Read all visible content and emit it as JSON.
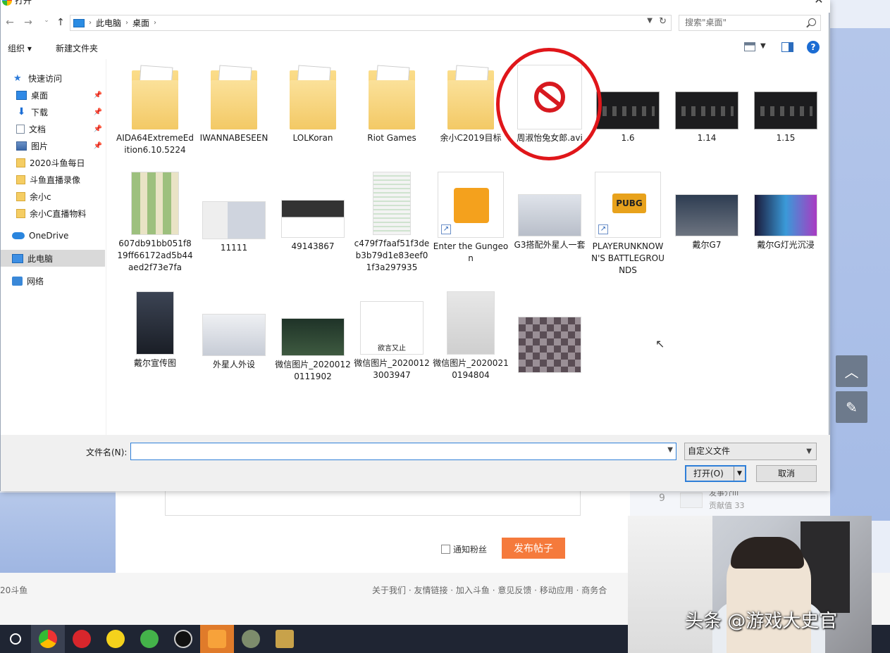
{
  "dialog": {
    "title": "打开",
    "breadcrumb": [
      "此电脑",
      "桌面"
    ],
    "search_placeholder": "搜索\"桌面\"",
    "toolbar": {
      "organize": "组织 ▾",
      "new_folder": "新建文件夹"
    },
    "nav": [
      {
        "label": "快速访问",
        "icon": "star-icon"
      },
      {
        "label": "桌面",
        "icon": "desktop-icon",
        "pinned": true
      },
      {
        "label": "下载",
        "icon": "download-icon",
        "pinned": true
      },
      {
        "label": "文档",
        "icon": "document-icon",
        "pinned": true
      },
      {
        "label": "图片",
        "icon": "pictures-icon",
        "pinned": true
      },
      {
        "label": "2020斗鱼每日",
        "icon": "folder-icon"
      },
      {
        "label": "斗鱼直播录像",
        "icon": "folder-icon"
      },
      {
        "label": "余小c",
        "icon": "folder-icon"
      },
      {
        "label": "余小C直播物料",
        "icon": "folder-icon"
      },
      {
        "label": "OneDrive",
        "icon": "cloud-icon"
      },
      {
        "label": "此电脑",
        "icon": "pc-icon"
      },
      {
        "label": "网络",
        "icon": "network-icon"
      }
    ],
    "files_row1": [
      {
        "name": "AIDA64ExtremeEdition6.10.5224",
        "kind": "folder"
      },
      {
        "name": "IWANNABESEEN",
        "kind": "folder"
      },
      {
        "name": "LOLKoran",
        "kind": "folder"
      },
      {
        "name": "Riot Games",
        "kind": "folder"
      },
      {
        "name": "余小C2019目标",
        "kind": "folder"
      },
      {
        "name": "周淑怡兔女郎.avi",
        "kind": "blocked"
      },
      {
        "name": "1.6",
        "kind": "dark"
      },
      {
        "name": "1.14",
        "kind": "dark"
      },
      {
        "name": "1.15",
        "kind": "dark"
      }
    ],
    "files_row2": [
      {
        "name": "607db91bb051f819ff66172ad5b44aed2f73e7fa"
      },
      {
        "name": "11111"
      },
      {
        "name": "49143867"
      },
      {
        "name": "c479f7faaf51f3deb3b79d1e83eef01f3a297935"
      },
      {
        "name": "Enter the Gungeon"
      },
      {
        "name": "G3搭配外星人一套"
      },
      {
        "name": "PLAYERUNKNOWN'S BATTLEGROUNDS"
      },
      {
        "name": "戴尔G7"
      },
      {
        "name": "戴尔G灯光沉浸"
      }
    ],
    "files_row3": [
      {
        "name": "戴尔宣传图"
      },
      {
        "name": "外星人外设"
      },
      {
        "name": "微信图片_20200120111902"
      },
      {
        "name": "微信图片_20200123003947"
      },
      {
        "name": "微信图片_20200210194804"
      },
      {
        "name": ""
      }
    ],
    "pubg_text": "PUBG",
    "meme_text": "欲言又止",
    "filename_label": "文件名(N):",
    "filename_value": "",
    "filetype": "自定义文件",
    "open_label": "打开(O)",
    "cancel_label": "取消"
  },
  "page": {
    "notify_label": "通知粉丝",
    "publish_label": "发布帖子",
    "rank_num": "9",
    "rank_name": "发事介ili",
    "rank_score": "贡献值 33",
    "footer_left": "20斗鱼",
    "footer_links": "关于我们 · 友情链接 · 加入斗鱼 · 意见反馈 · 移动应用 · 商务合",
    "watermark": "头条 @游戏大史官"
  },
  "colors": {
    "accent": "#2f7fd8",
    "publish": "#f57a3c",
    "annotation_circle": "#e0161a"
  }
}
